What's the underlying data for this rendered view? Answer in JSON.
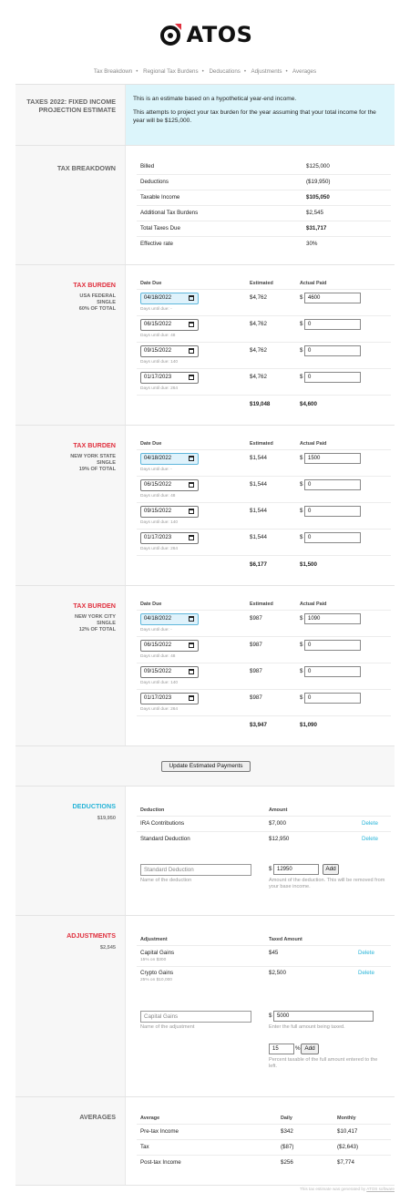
{
  "brand": {
    "name": "ATOS"
  },
  "nav": [
    "Tax Breakdown",
    "Regional Tax Burdens",
    "Deducations",
    "Adjustments",
    "Averages"
  ],
  "intro": {
    "title": "TAXES 2022: FIXED INCOME PROJECTION ESTIMATE",
    "line1": "This is an estimate based on a hypothetical year-end income.",
    "line2": "This attempts to project your tax burden for the year assuming that your total income for the year will be $125,000."
  },
  "breakdown": {
    "title": "TAX BREAKDOWN",
    "rows": [
      {
        "label": "Billed",
        "value": "$125,000"
      },
      {
        "label": "Deductions",
        "value": "($19,950)"
      },
      {
        "label": "Taxable Income",
        "value": "$105,050"
      },
      {
        "label": "Additional Tax Burdens",
        "value": "$2,545"
      },
      {
        "label": "Total Taxes Due",
        "value": "$31,717"
      },
      {
        "label": "Effective rate",
        "value": "30%"
      }
    ]
  },
  "burden_headers": {
    "date": "Date Due",
    "estimated": "Estimated",
    "paid": "Actual Paid"
  },
  "burdens": [
    {
      "title": "TAX BURDEN",
      "line1": "USA FEDERAL",
      "line2": "SINGLE",
      "line3": "60% OF TOTAL",
      "rows": [
        {
          "date": "04/18/2022",
          "due": "Days until due: -",
          "est": "$4,762",
          "paid": "4600"
        },
        {
          "date": "06/15/2022",
          "due": "Days until due: 48",
          "est": "$4,762",
          "paid": "0"
        },
        {
          "date": "09/15/2022",
          "due": "Days until due: 140",
          "est": "$4,762",
          "paid": "0"
        },
        {
          "date": "01/17/2023",
          "due": "Days until due: 264",
          "est": "$4,762",
          "paid": "0"
        }
      ],
      "total_est": "$19,048",
      "total_paid": "$4,600"
    },
    {
      "title": "TAX BURDEN",
      "line1": "NEW YORK STATE",
      "line2": "SINGLE",
      "line3": "19% OF TOTAL",
      "rows": [
        {
          "date": "04/18/2022",
          "due": "Days until due: -",
          "est": "$1,544",
          "paid": "1500"
        },
        {
          "date": "06/15/2022",
          "due": "Days until due: 48",
          "est": "$1,544",
          "paid": "0"
        },
        {
          "date": "09/15/2022",
          "due": "Days until due: 140",
          "est": "$1,544",
          "paid": "0"
        },
        {
          "date": "01/17/2023",
          "due": "Days until due: 264",
          "est": "$1,544",
          "paid": "0"
        }
      ],
      "total_est": "$6,177",
      "total_paid": "$1,500"
    },
    {
      "title": "TAX BURDEN",
      "line1": "NEW YORK CITY",
      "line2": "SINGLE",
      "line3": "12% OF TOTAL",
      "rows": [
        {
          "date": "04/18/2022",
          "due": "Days until due: -",
          "est": "$987",
          "paid": "1090"
        },
        {
          "date": "06/15/2022",
          "due": "Days until due: 48",
          "est": "$987",
          "paid": "0"
        },
        {
          "date": "09/15/2022",
          "due": "Days until due: 140",
          "est": "$987",
          "paid": "0"
        },
        {
          "date": "01/17/2023",
          "due": "Days until due: 264",
          "est": "$987",
          "paid": "0"
        }
      ],
      "total_est": "$3,947",
      "total_paid": "$1,090"
    }
  ],
  "update_button": "Update Estimated Payments",
  "deductions": {
    "title": "DEDUCTIONS",
    "total": "$19,950",
    "col1": "Deduction",
    "col2": "Amount",
    "rows": [
      {
        "name": "IRA Contributions",
        "amount": "$7,000",
        "action": "Delete"
      },
      {
        "name": "Standard Deduction",
        "amount": "$12,950",
        "action": "Delete"
      }
    ],
    "name_value": "Standard Deduction",
    "name_help": "Name of the deduction",
    "amount_prefix": "$",
    "amount_value": "12950",
    "add_label": "Add",
    "amount_help": "Amount of the deduction. This will be removed from your base income."
  },
  "adjustments": {
    "title": "ADJUSTMENTS",
    "total": "$2,545",
    "col1": "Adjustment",
    "col2": "Taxed Amount",
    "rows": [
      {
        "name": "Capital Gains",
        "sub": "15% on $300",
        "amount": "$45",
        "action": "Delete"
      },
      {
        "name": "Crypto Gains",
        "sub": "25% on $10,000",
        "amount": "$2,500",
        "action": "Delete"
      }
    ],
    "name_value": "Capital Gains",
    "name_help": "Name of the adjustment",
    "amount_prefix": "$",
    "amount_value": "5000",
    "amount_help": "Enter the full amount being taxed.",
    "percent_value": "15",
    "percent_suffix": "%",
    "add_label": "Add",
    "percent_help": "Percent taxable of the full amount entered to the left."
  },
  "averages": {
    "title": "AVERAGES",
    "col1": "Average",
    "col2": "Daily",
    "col3": "Monthly",
    "rows": [
      {
        "label": "Pre-tax Income",
        "daily": "$342",
        "monthly": "$10,417"
      },
      {
        "label": "Tax",
        "daily": "($87)",
        "monthly": "($2,643)"
      },
      {
        "label": "Post-tax Income",
        "daily": "$256",
        "monthly": "$7,774"
      }
    ]
  },
  "footer": {
    "prefix": "This tax estimate was generated by",
    "link": "ATOS software"
  },
  "colors": {
    "accent_red": "#e0313f",
    "accent_blue": "#27b4d8",
    "intro_bg": "#dcf5fb"
  }
}
